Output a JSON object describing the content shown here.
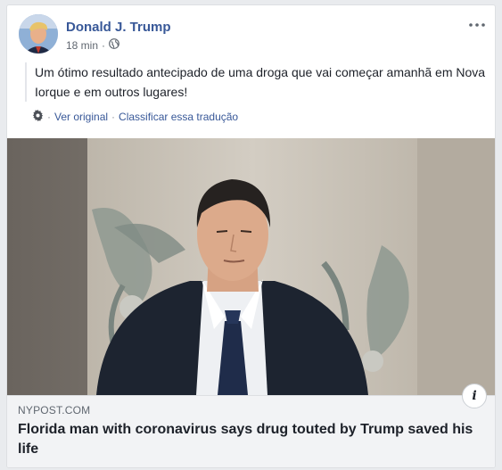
{
  "post": {
    "author": "Donald J. Trump",
    "time": "18 min",
    "separator": "·",
    "privacy_icon": "globe-icon",
    "text": "Um ótimo resultado antecipado de uma droga que vai começar amanhã em Nova Iorque e em outros lugares!",
    "more_icon": "more-horizontal-icon"
  },
  "translation": {
    "settings_icon": "gear-icon",
    "see_original": "Ver original",
    "separator": "·",
    "rate": "Classificar essa tradução"
  },
  "link": {
    "domain": "NYPOST.COM",
    "headline": "Florida man with coronavirus says drug touted by Trump saved his life",
    "info_label": "i"
  },
  "colors": {
    "author_link": "#385898",
    "text": "#1d2129",
    "meta": "#606770",
    "footer_bg": "#f2f3f5"
  }
}
